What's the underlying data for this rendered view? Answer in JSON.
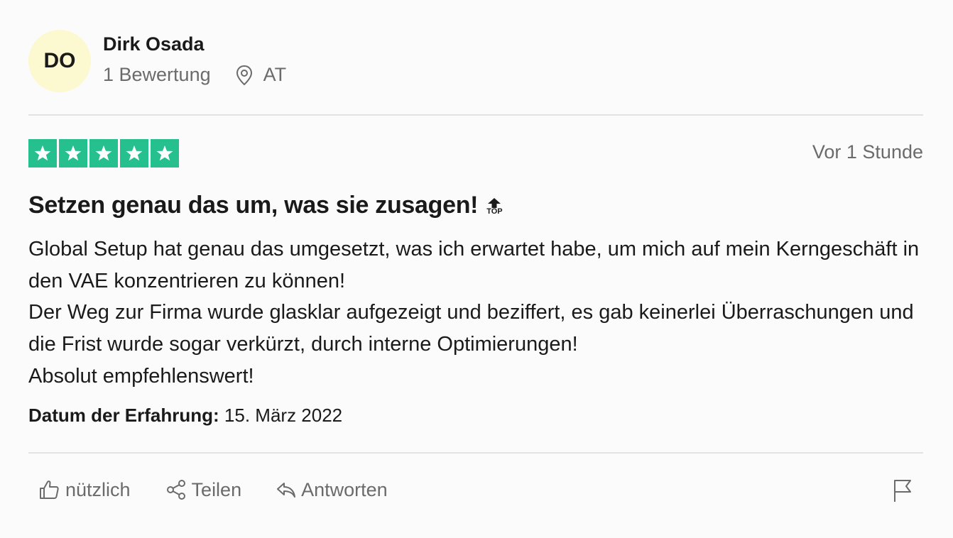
{
  "reviewer": {
    "initials": "DO",
    "name": "Dirk Osada",
    "review_count": "1 Bewertung",
    "location": "AT",
    "avatar_color": "#fcf8cf"
  },
  "review": {
    "rating": 5,
    "star_color": "#00b67a",
    "time_ago": "Vor 1 Stunde",
    "title": "Setzen genau das um, was sie zusagen!",
    "badge_text": "TOP",
    "body_lines": [
      "Global Setup hat genau das umgesetzt, was ich erwartet habe, um mich auf mein Kerngeschäft in den VAE konzentrieren zu können!",
      "Der Weg zur Firma wurde glasklar aufgezeigt und beziffert, es gab keinerlei Überraschungen und die Frist wurde sogar verkürzt, durch interne Optimierungen!",
      "Absolut empfehlenswert!"
    ],
    "experience_label": "Datum der Erfahrung:",
    "experience_date": "15. März 2022"
  },
  "actions": {
    "useful_label": "nützlich",
    "share_label": "Teilen",
    "reply_label": "Antworten",
    "icons": [
      "thumbs-up-icon",
      "share-icon",
      "reply-icon",
      "flag-icon"
    ]
  }
}
